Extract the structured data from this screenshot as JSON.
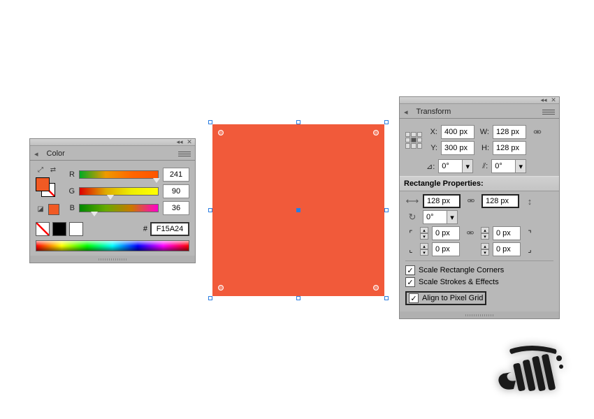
{
  "color_panel": {
    "tab_label": "Color",
    "channels": {
      "r": {
        "label": "R",
        "value": "241",
        "pos_pct": 94
      },
      "g": {
        "label": "G",
        "value": "90",
        "pos_pct": 35
      },
      "b": {
        "label": "B",
        "value": "36",
        "pos_pct": 14
      }
    },
    "hex_prefix": "#",
    "hex_value": "F15A24",
    "fill_color": "#f15a24"
  },
  "artboard": {
    "rect_color": "#f15a3a"
  },
  "transform_panel": {
    "tab_label": "Transform",
    "x_label": "X:",
    "y_label": "Y:",
    "w_label": "W:",
    "h_label": "H:",
    "x_value": "400 px",
    "y_value": "300 px",
    "w_value": "128 px",
    "h_value": "128 px",
    "rotate_label": "⊿:",
    "rotate_value": "0°",
    "shear_label": "⫽:",
    "shear_value": "0°",
    "section_title": "Rectangle Properties:",
    "rect_w": "128 px",
    "rect_h": "128 px",
    "rect_rotate": "0°",
    "corner_tl": "0 px",
    "corner_tr": "0 px",
    "corner_bl": "0 px",
    "corner_br": "0 px",
    "scale_corners_label": "Scale Rectangle Corners",
    "scale_strokes_label": "Scale Strokes & Effects",
    "align_grid_label": "Align to Pixel Grid",
    "scale_corners_on": true,
    "scale_strokes_on": true,
    "align_grid_on": true
  }
}
